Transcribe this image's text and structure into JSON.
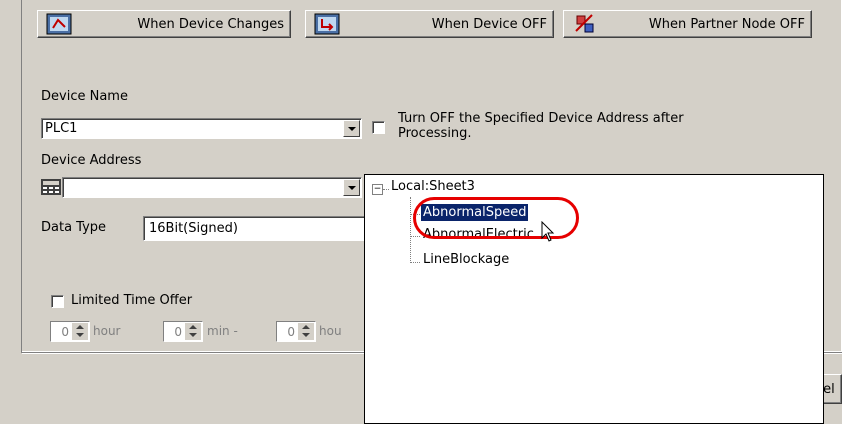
{
  "triggers": [
    {
      "label": "When Device Changes",
      "icon": "device-change-icon"
    },
    {
      "label": "When Device OFF",
      "icon": "device-off-icon"
    },
    {
      "label": "When Partner Node OFF",
      "icon": "partner-node-off-icon"
    }
  ],
  "device_name": {
    "label": "Device Name",
    "value": "PLC1"
  },
  "turn_off": {
    "label_line1": "Turn OFF the Specified Device Address after",
    "label_line2": "Processing.",
    "checked": false
  },
  "device_address": {
    "label": "Device Address",
    "value": ""
  },
  "data_type": {
    "label": "Data Type",
    "value": "16Bit(Signed)"
  },
  "limited_time": {
    "label": "Limited Time Offer",
    "checked": false
  },
  "time_fields": [
    {
      "value": "0",
      "unit": "hour"
    },
    {
      "value": "0",
      "unit": "min -"
    },
    {
      "value": "0",
      "unit": "hou"
    }
  ],
  "cancel_fragment": "cel",
  "tree": {
    "root": "Local:Sheet3",
    "root_toggle": "−",
    "items": [
      "AbnormalSpeed",
      "AbnormalElectric",
      "LineBlockage"
    ],
    "selected_index": 0,
    "highlight_color": "#0a246a",
    "annotation_color": "#e60000"
  }
}
